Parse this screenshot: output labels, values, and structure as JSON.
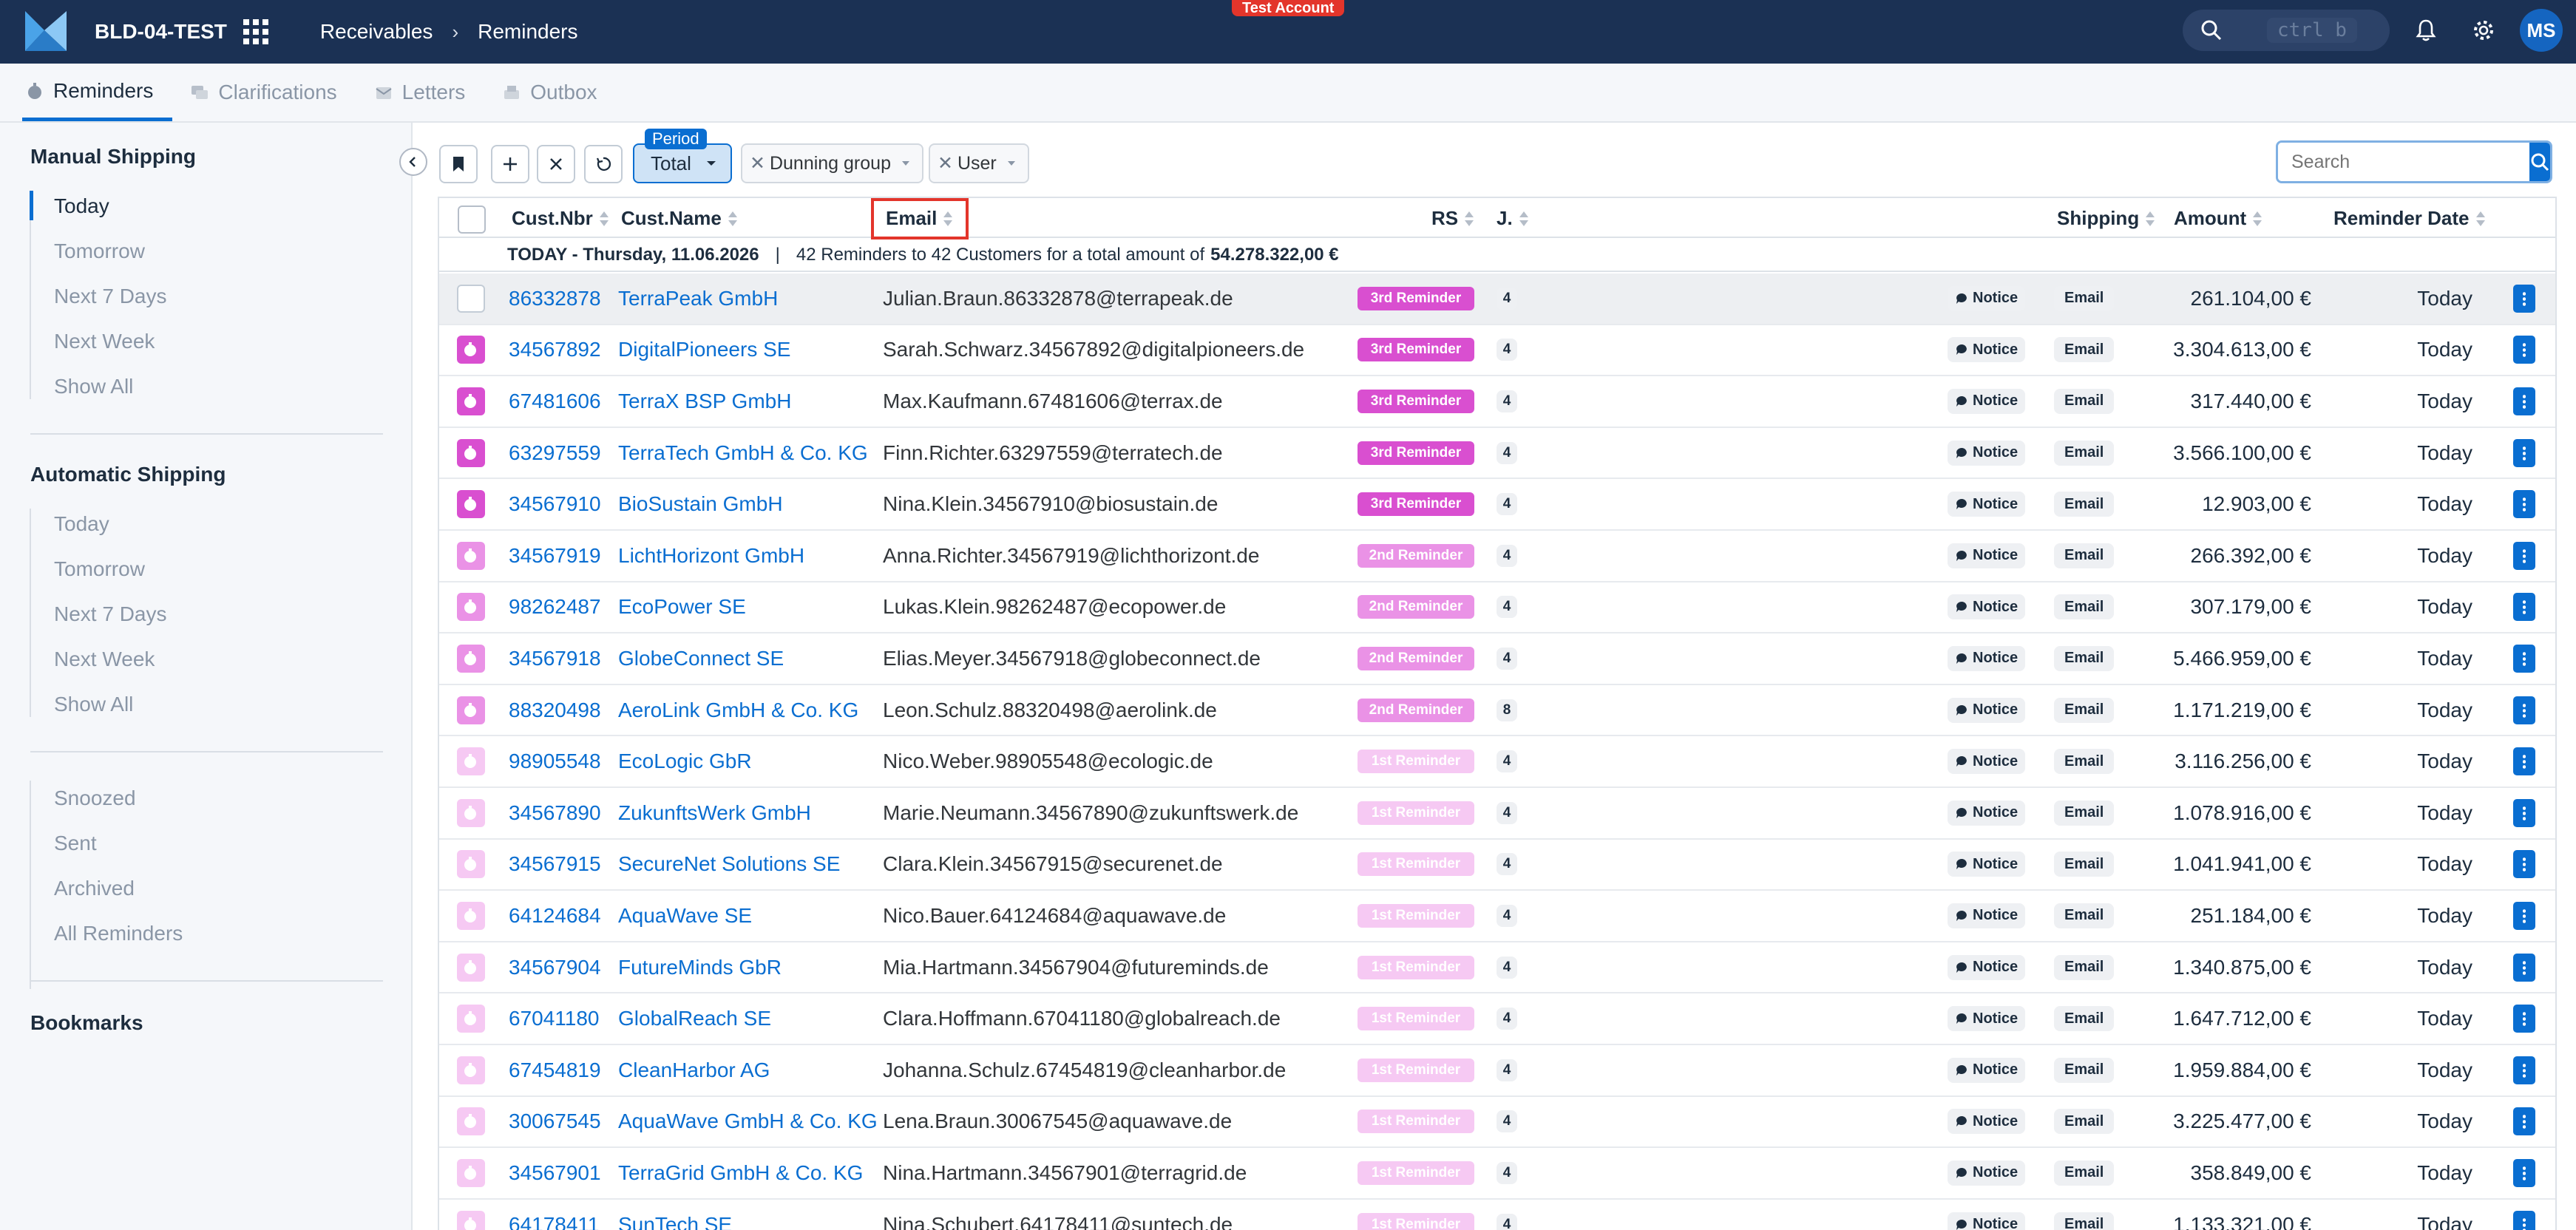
{
  "header": {
    "system": "BLD-04-TEST",
    "breadcrumb": [
      "Receivables",
      "Reminders"
    ],
    "test_badge": "Test Account",
    "search_hint": "ctrl b",
    "avatar": "MS"
  },
  "tabs": [
    {
      "label": "Reminders",
      "icon": "stopwatch-icon",
      "active": true
    },
    {
      "label": "Clarifications",
      "icon": "chat-icon",
      "active": false
    },
    {
      "label": "Letters",
      "icon": "letters-icon",
      "active": false
    },
    {
      "label": "Outbox",
      "icon": "outbox-icon",
      "active": false
    }
  ],
  "sidebar": {
    "manual": {
      "title": "Manual Shipping",
      "items": [
        "Today",
        "Tomorrow",
        "Next 7 Days",
        "Next Week",
        "Show All"
      ]
    },
    "automatic": {
      "title": "Automatic Shipping",
      "items": [
        "Today",
        "Tomorrow",
        "Next 7 Days",
        "Next Week",
        "Show All"
      ]
    },
    "other": [
      "Snoozed",
      "Sent",
      "Archived",
      "All Reminders"
    ],
    "bookmarks": "Bookmarks"
  },
  "toolbar": {
    "period_label": "Period",
    "period_value": "Total",
    "filters": [
      "Dunning group",
      "User"
    ],
    "search_placeholder": "Search"
  },
  "table": {
    "columns": {
      "cust_nbr": "Cust.Nbr",
      "cust_name": "Cust.Name",
      "email": "Email",
      "rs": "RS",
      "j": "J.",
      "shipping": "Shipping",
      "amount": "Amount",
      "reminder_date": "Reminder Date"
    },
    "summary": {
      "date": "TODAY - Thursday, 11.06.2026",
      "sep": "|",
      "text": "42 Reminders to 42 Customers for a total amount of",
      "total": "54.278.322,00 €"
    },
    "notice_label": "Notice",
    "email_label": "Email",
    "status_colors": {
      "3rd Reminder": "#d94fd0",
      "2nd Reminder": "#ea92e6",
      "1st Reminder": "#f6c9f3"
    },
    "rows": [
      {
        "nbr": "86332878",
        "name": "TerraPeak GmbH",
        "email": "Julian.Braun.86332878@terrapeak.de",
        "rs": "3rd Reminder",
        "j": "4",
        "amount": "261.104,00 €",
        "date": "Today",
        "selected": true
      },
      {
        "nbr": "34567892",
        "name": "DigitalPioneers SE",
        "email": "Sarah.Schwarz.34567892@digitalpioneers.de",
        "rs": "3rd Reminder",
        "j": "4",
        "amount": "3.304.613,00 €",
        "date": "Today"
      },
      {
        "nbr": "67481606",
        "name": "TerraX BSP GmbH",
        "email": "Max.Kaufmann.67481606@terrax.de",
        "rs": "3rd Reminder",
        "j": "4",
        "amount": "317.440,00 €",
        "date": "Today"
      },
      {
        "nbr": "63297559",
        "name": "TerraTech GmbH & Co. KG",
        "email": "Finn.Richter.63297559@terratech.de",
        "rs": "3rd Reminder",
        "j": "4",
        "amount": "3.566.100,00 €",
        "date": "Today"
      },
      {
        "nbr": "34567910",
        "name": "BioSustain GmbH",
        "email": "Nina.Klein.34567910@biosustain.de",
        "rs": "3rd Reminder",
        "j": "4",
        "amount": "12.903,00 €",
        "date": "Today"
      },
      {
        "nbr": "34567919",
        "name": "LichtHorizont GmbH",
        "email": "Anna.Richter.34567919@lichthorizont.de",
        "rs": "2nd Reminder",
        "j": "4",
        "amount": "266.392,00 €",
        "date": "Today"
      },
      {
        "nbr": "98262487",
        "name": "EcoPower SE",
        "email": "Lukas.Klein.98262487@ecopower.de",
        "rs": "2nd Reminder",
        "j": "4",
        "amount": "307.179,00 €",
        "date": "Today"
      },
      {
        "nbr": "34567918",
        "name": "GlobeConnect SE",
        "email": "Elias.Meyer.34567918@globeconnect.de",
        "rs": "2nd Reminder",
        "j": "4",
        "amount": "5.466.959,00 €",
        "date": "Today"
      },
      {
        "nbr": "88320498",
        "name": "AeroLink GmbH & Co. KG",
        "email": "Leon.Schulz.88320498@aerolink.de",
        "rs": "2nd Reminder",
        "j": "8",
        "amount": "1.171.219,00 €",
        "date": "Today"
      },
      {
        "nbr": "98905548",
        "name": "EcoLogic GbR",
        "email": "Nico.Weber.98905548@ecologic.de",
        "rs": "1st Reminder",
        "j": "4",
        "amount": "3.116.256,00 €",
        "date": "Today"
      },
      {
        "nbr": "34567890",
        "name": "ZukunftsWerk GmbH",
        "email": "Marie.Neumann.34567890@zukunftswerk.de",
        "rs": "1st Reminder",
        "j": "4",
        "amount": "1.078.916,00 €",
        "date": "Today"
      },
      {
        "nbr": "34567915",
        "name": "SecureNet Solutions SE",
        "email": "Clara.Klein.34567915@securenet.de",
        "rs": "1st Reminder",
        "j": "4",
        "amount": "1.041.941,00 €",
        "date": "Today"
      },
      {
        "nbr": "64124684",
        "name": "AquaWave SE",
        "email": "Nico.Bauer.64124684@aquawave.de",
        "rs": "1st Reminder",
        "j": "4",
        "amount": "251.184,00 €",
        "date": "Today"
      },
      {
        "nbr": "34567904",
        "name": "FutureMinds GbR",
        "email": "Mia.Hartmann.34567904@futureminds.de",
        "rs": "1st Reminder",
        "j": "4",
        "amount": "1.340.875,00 €",
        "date": "Today"
      },
      {
        "nbr": "67041180",
        "name": "GlobalReach SE",
        "email": "Clara.Hoffmann.67041180@globalreach.de",
        "rs": "1st Reminder",
        "j": "4",
        "amount": "1.647.712,00 €",
        "date": "Today"
      },
      {
        "nbr": "67454819",
        "name": "CleanHarbor AG",
        "email": "Johanna.Schulz.67454819@cleanharbor.de",
        "rs": "1st Reminder",
        "j": "4",
        "amount": "1.959.884,00 €",
        "date": "Today"
      },
      {
        "nbr": "30067545",
        "name": "AquaWave GmbH & Co. KG",
        "email": "Lena.Braun.30067545@aquawave.de",
        "rs": "1st Reminder",
        "j": "4",
        "amount": "3.225.477,00 €",
        "date": "Today"
      },
      {
        "nbr": "34567901",
        "name": "TerraGrid GmbH & Co. KG",
        "email": "Nina.Hartmann.34567901@terragrid.de",
        "rs": "1st Reminder",
        "j": "4",
        "amount": "358.849,00 €",
        "date": "Today"
      },
      {
        "nbr": "64178411",
        "name": "SunTech SE",
        "email": "Nina.Schubert.64178411@suntech.de",
        "rs": "1st Reminder",
        "j": "4",
        "amount": "1.133.321,00 €",
        "date": "Today"
      }
    ]
  }
}
